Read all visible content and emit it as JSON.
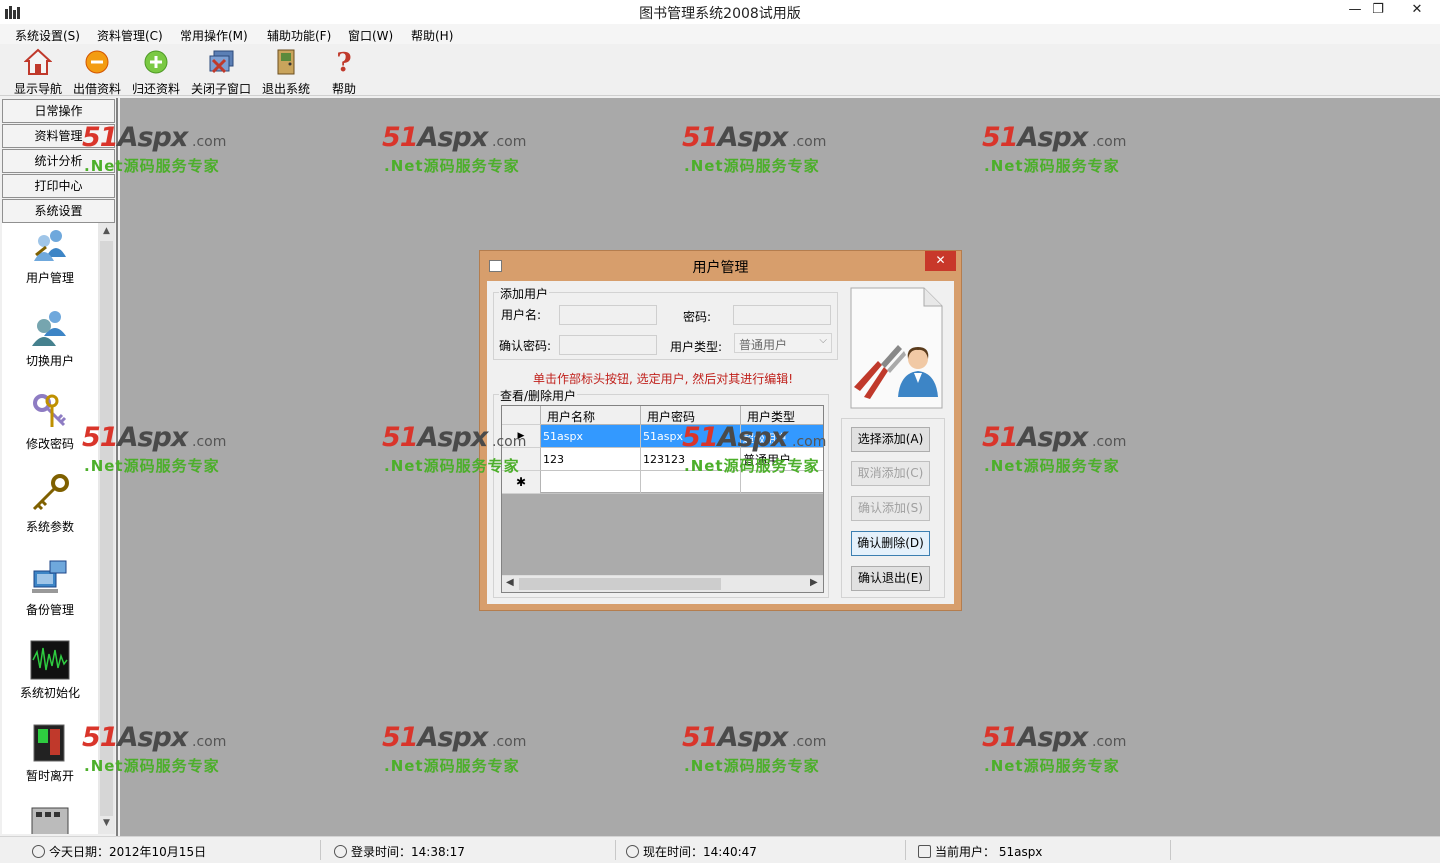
{
  "window": {
    "title": "图书管理系统2008试用版",
    "controls": {
      "minimize": "—",
      "restore": "❐",
      "close": "✕"
    }
  },
  "menu": [
    "系统设置(S)",
    "资料管理(C)",
    "常用操作(M)",
    "辅助功能(F)",
    "窗口(W)",
    "帮助(H)"
  ],
  "toolbar": [
    {
      "label": "显示导航",
      "icon": "house-icon"
    },
    {
      "label": "出借资料",
      "icon": "minus-circle-icon"
    },
    {
      "label": "归还资料",
      "icon": "plus-circle-icon"
    },
    {
      "label": "关闭子窗口",
      "icon": "close-window-icon"
    },
    {
      "label": "退出系统",
      "icon": "exit-door-icon"
    },
    {
      "label": "帮助",
      "icon": "help-icon"
    }
  ],
  "nav": {
    "headers": [
      "日常操作",
      "资料管理",
      "统计分析",
      "打印中心",
      "系统设置"
    ],
    "items": [
      {
        "label": "用户管理",
        "icon": "users-icon"
      },
      {
        "label": "切换用户",
        "icon": "switch-user-icon"
      },
      {
        "label": "修改密码",
        "icon": "keys-icon"
      },
      {
        "label": "系统参数",
        "icon": "key-icon"
      },
      {
        "label": "备份管理",
        "icon": "backup-computer-icon"
      },
      {
        "label": "系统初始化",
        "icon": "oscilloscope-icon"
      },
      {
        "label": "暂时离开",
        "icon": "exit-door-icon"
      }
    ],
    "scroll": {
      "up": "▲",
      "down": "▼"
    }
  },
  "watermark": {
    "num": "51",
    "brand": "Aspx",
    "dotcom": ".com",
    "sub": ".Net源码服务专家"
  },
  "dialog": {
    "title": "用户管理",
    "close": "✕",
    "add_group": "添加用户",
    "username_label": "用户名:",
    "password_label": "密码:",
    "confirm_label": "确认密码:",
    "usertype_label": "用户类型:",
    "usertype_value": "普通用户",
    "hint": "单击作部标头按钮, 选定用户, 然后对其进行编辑!",
    "list_group": "查看/删除用户",
    "columns": [
      "用户名称",
      "用户密码",
      "用户类型"
    ],
    "rows": [
      {
        "marker": "▶",
        "cells": [
          "51aspx",
          "51aspx",
          "超级用户"
        ]
      },
      {
        "marker": "",
        "cells": [
          "123",
          "123123",
          "普通用户"
        ]
      },
      {
        "marker": "✱",
        "cells": [
          "",
          "",
          ""
        ]
      }
    ],
    "buttons": {
      "select_add": "选择添加(A)",
      "cancel_add": "取消添加(C)",
      "confirm_add": "确认添加(S)",
      "confirm_delete": "确认删除(D)",
      "confirm_exit": "确认退出(E)"
    },
    "hscroll": {
      "left": "◀",
      "right": "▶"
    }
  },
  "status": {
    "date": "今天日期：2012年10月15日",
    "login": "登录时间：14:38:17",
    "now": "现在时间：14:40:47",
    "user": "当前用户： 51aspx"
  },
  "colors": {
    "mdi_bg": "#a9a9a9",
    "dialog_frame": "#d79e6c",
    "selection": "#3399ff",
    "hint": "#c0211c",
    "watermark_green": "#4caf2a",
    "watermark_red": "#d9352b"
  }
}
